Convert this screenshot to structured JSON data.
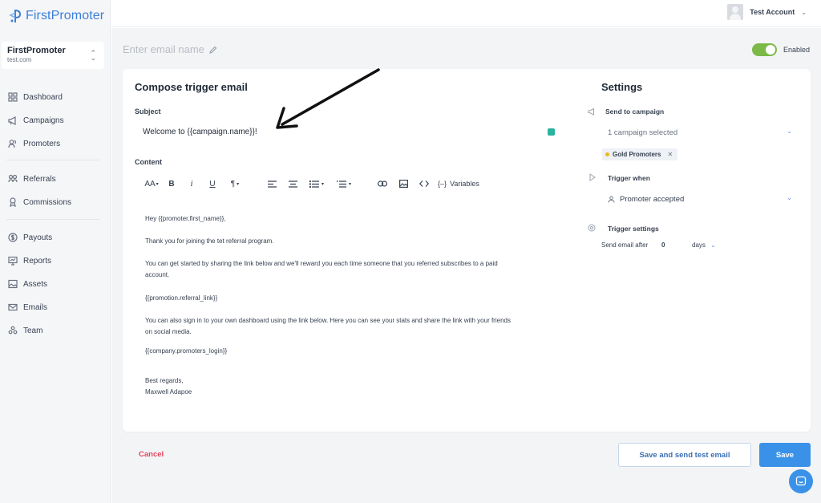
{
  "app": {
    "logo_text": "FirstPromoter",
    "brand_color": "#3b7fd9"
  },
  "account": {
    "name": "FirstPromoter",
    "domain": "test.com"
  },
  "sidebar": {
    "items": [
      {
        "label": "Dashboard",
        "icon": "dashboard-icon"
      },
      {
        "label": "Campaigns",
        "icon": "megaphone-icon"
      },
      {
        "label": "Promoters",
        "icon": "users-icon"
      },
      {
        "label": "Referrals",
        "icon": "referrals-icon"
      },
      {
        "label": "Commissions",
        "icon": "commission-icon"
      },
      {
        "label": "Payouts",
        "icon": "dollar-icon"
      },
      {
        "label": "Reports",
        "icon": "reports-icon"
      },
      {
        "label": "Assets",
        "icon": "image-icon"
      },
      {
        "label": "Emails",
        "icon": "envelope-icon"
      },
      {
        "label": "Team",
        "icon": "team-icon"
      }
    ]
  },
  "topbar": {
    "user_name": "Test Account"
  },
  "header": {
    "email_name_placeholder": "Enter email name",
    "toggle_label": "Enabled",
    "toggle_on": true,
    "toggle_color": "#7cb947"
  },
  "compose": {
    "title": "Compose trigger email",
    "subject_label": "Subject",
    "subject_value": "Welcome to {{campaign.name}}!",
    "content_label": "Content",
    "toolbar": {
      "font_size": "AA",
      "bold": "B",
      "italic": "i",
      "underline": "U",
      "paragraph": "¶",
      "variables": "Variables"
    },
    "body": [
      "Hey {{promoter.first_name}},",
      "Thank you for joining the tet referral program.",
      "You can get started by sharing the link below and we'll reward you each time someone that you referred subscribes to a paid",
      "account.",
      "{{promotion.referral_link}}",
      "You can also sign in to your own dashboard using the link below. Here you can see your stats and share the link with your friends",
      "on social media.",
      "{{company.promoters_login}}",
      "Best regards,",
      "Maxwell Adapoe"
    ]
  },
  "settings": {
    "title": "Settings",
    "send_to_label": "Send to campaign",
    "campaign_select": "1 campaign selected",
    "campaign_tag": "Gold Promoters",
    "trigger_when_label": "Trigger when",
    "trigger_value": "Promoter accepted",
    "trigger_settings_label": "Trigger settings",
    "send_after_label": "Send email after",
    "send_after_value": "0",
    "send_after_unit": "days"
  },
  "actions": {
    "cancel": "Cancel",
    "save_test": "Save and send test email",
    "save": "Save"
  }
}
